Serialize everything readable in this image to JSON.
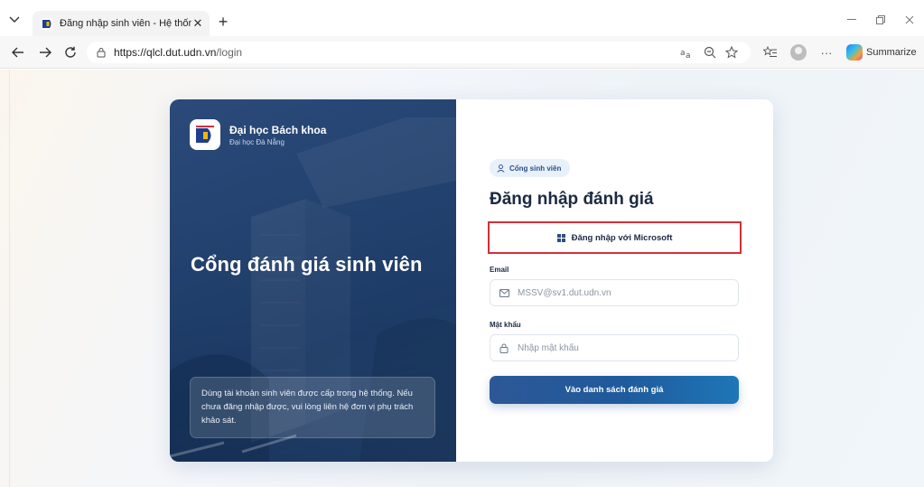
{
  "browser": {
    "tab_title": "Đăng nhập sinh viên - Hệ thống đ",
    "tab_close": "✕",
    "new_tab": "+",
    "url_host": "https://qlcl.dut.udn.vn",
    "url_path": "/login",
    "summarize_label": "Summarize",
    "more_label": "···"
  },
  "brand": {
    "name": "Đại học Bách khoa",
    "subtitle": "Đại học Đà Nẵng"
  },
  "hero": {
    "title": "Cổng đánh giá sinh viên",
    "note": "Dùng tài khoản sinh viên được cấp trong hệ thống. Nếu chưa đăng nhập được, vui lòng liên hệ đơn vị phụ trách khảo sát."
  },
  "form": {
    "portal_pill": "Cổng sinh viên",
    "title": "Đăng nhập đánh giá",
    "microsoft_button": "Đăng nhập với Microsoft",
    "email_label": "Email",
    "email_placeholder": "MSSV@sv1.dut.udn.vn",
    "password_label": "Mật khẩu",
    "password_placeholder": "Nhập mật khẩu",
    "submit_button": "Vào danh sách đánh giá"
  },
  "colors": {
    "hero_blue": "#23426f",
    "primary_button": "#1f5b9c",
    "highlight_red": "#d32f3a"
  },
  "icons": {
    "tab_list": "chevron-down-icon",
    "favicon": "dut-logo-icon",
    "back": "back-arrow-icon",
    "forward": "forward-arrow-icon",
    "refresh": "refresh-icon",
    "site_info": "lock-icon",
    "read_aloud": "read-aloud-icon",
    "zoom": "zoom-icon",
    "favorite": "star-icon",
    "favorites": "favorites-list-icon",
    "profile": "avatar",
    "copilot": "copilot-icon",
    "portal": "user-icon",
    "microsoft": "microsoft-icon",
    "email": "mail-icon",
    "password": "lock-icon"
  }
}
